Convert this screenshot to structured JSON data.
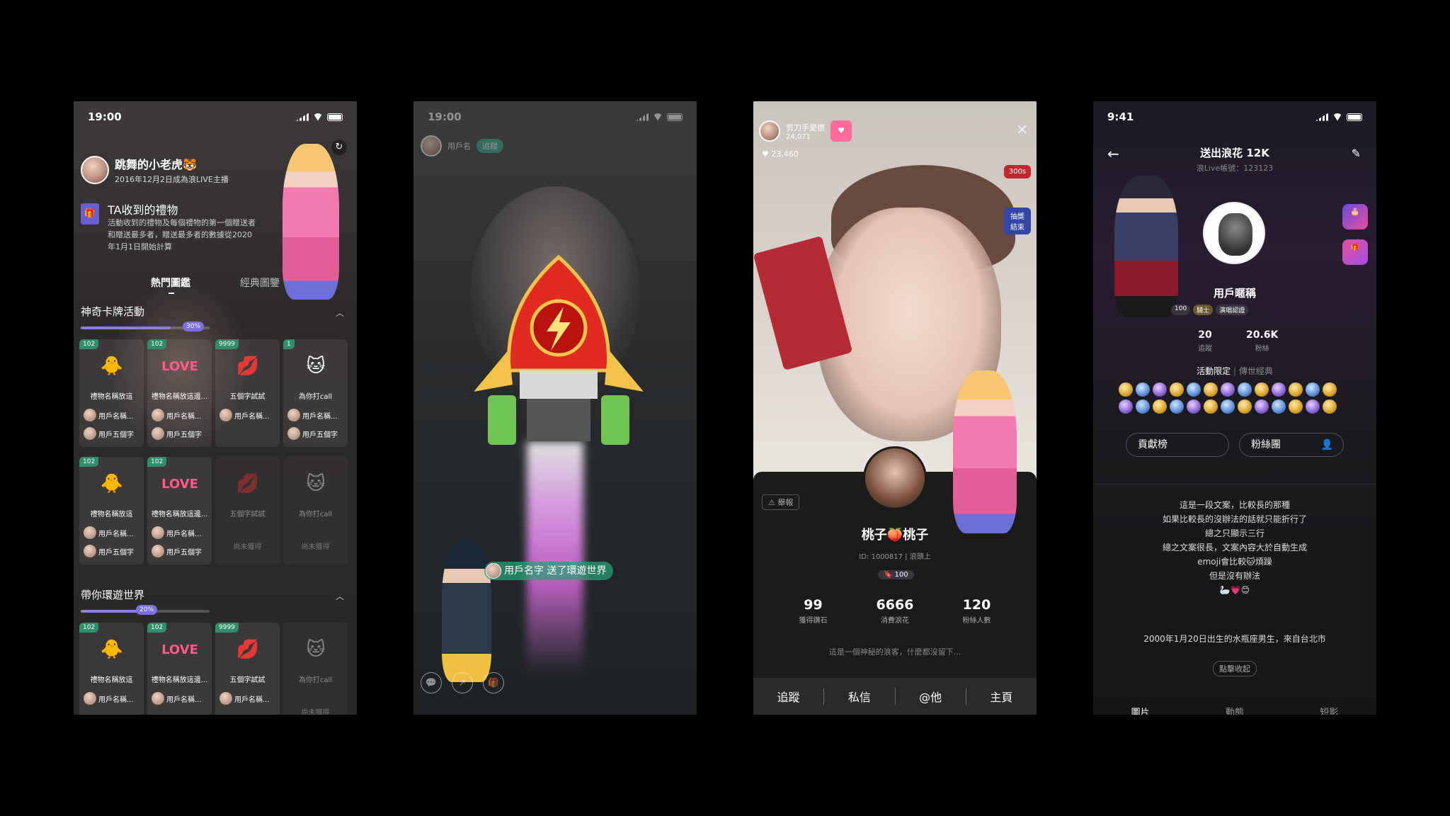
{
  "phone1": {
    "status_time": "19:00",
    "user_name": "跳舞的小老虎🐯",
    "user_sub": "2016年12月2日成為浪LIVE主播",
    "section_title": "TA收到的禮物",
    "section_desc": "活動收到的禮物及每個禮物的第一個贈送者和贈送最多者，贈送最多者的數據從2020年1月1日開始計算",
    "tab_hot": "熱門圖鑑",
    "tab_classic": "經典圖鑒",
    "group1_title": "神奇卡牌活動",
    "group1_progress": "30%",
    "group2_title": "帶你環遊世界",
    "group2_progress": "20%",
    "cards": [
      {
        "badge": "102",
        "name": "禮物名稱放這",
        "u1": "用戶名稱...",
        "u2": "用戶五個字",
        "icon": "🐥"
      },
      {
        "badge": "102",
        "name": "禮物名稱放這邊...",
        "u1": "用戶名稱...",
        "u2": "用戶五個字",
        "icon": "LOVE"
      },
      {
        "badge": "9999",
        "name": "五個字試試",
        "u1": "用戶名稱...",
        "u2": "",
        "icon": "💋"
      },
      {
        "badge": "1",
        "name": "為你打call",
        "u1": "用戶名稱...",
        "u2": "用戶五個字",
        "icon": "🐱"
      },
      {
        "badge": "102",
        "name": "禮物名稱放這",
        "u1": "用戶名稱...",
        "u2": "用戶五個字",
        "icon": "🐥"
      },
      {
        "badge": "102",
        "name": "禮物名稱放這邊...",
        "u1": "用戶名稱...",
        "u2": "用戶五個字",
        "icon": "LOVE"
      },
      {
        "badge": "",
        "name": "五個字試試",
        "u1": "",
        "u2": "",
        "icon": "💋",
        "locked": "尚未獲得"
      },
      {
        "badge": "",
        "name": "為你打call",
        "u1": "",
        "u2": "",
        "icon": "🐱",
        "locked": "尚未獲得"
      },
      {
        "badge": "102",
        "name": "禮物名稱放這",
        "u1": "用戶名稱...",
        "u2": "",
        "icon": "🐥"
      },
      {
        "badge": "102",
        "name": "禮物名稱放這邊...",
        "u1": "用戶名稱...",
        "u2": "",
        "icon": "LOVE"
      },
      {
        "badge": "9999",
        "name": "五個字試試",
        "u1": "用戶名稱...",
        "u2": "",
        "icon": "💋"
      },
      {
        "badge": "",
        "name": "為你打call",
        "u1": "",
        "u2": "",
        "icon": "🐱",
        "locked": "尚未獲得"
      }
    ]
  },
  "phone2": {
    "status_time": "19:00",
    "banner": "用戶名字 送了環遊世界",
    "top_name": "用戶名",
    "follow": "追蹤"
  },
  "phone3": {
    "top_name": "剪刀手愛德",
    "top_count": "24,071",
    "likes": "23,460",
    "side1": "300s",
    "side2_line1": "抽獎",
    "side2_line2": "結束",
    "report": "舉報",
    "name": "桃子🍑桃子",
    "id_line": "ID: 1000817 | 浪頭上",
    "level": "100",
    "stats": [
      {
        "v": "99",
        "l": "獲得鑽石"
      },
      {
        "v": "6666",
        "l": "消費浪花"
      },
      {
        "v": "120",
        "l": "粉絲人數"
      }
    ],
    "bio": "這是一個神秘的浪客，什麼都沒留下...",
    "actions": [
      "追蹤",
      "私信",
      "@他",
      "主頁"
    ]
  },
  "phone4": {
    "status_time": "9:41",
    "title": "送出浪花 12K",
    "account": "浪Live帳號：123123",
    "name": "用戶暱稱",
    "level": "100",
    "tag_knight": "騎士",
    "tag_verified": "演唱認證",
    "stats": [
      {
        "v": "20",
        "l": "追蹤"
      },
      {
        "v": "20.6K",
        "l": "粉絲"
      }
    ],
    "tab_active": "活動限定",
    "tab_other": "傳世經典",
    "contrib": "貢獻榜",
    "fans": "粉絲團",
    "bio_lines": [
      "這是一段文案，比較長的那種",
      "如果比較長的沒辦法的話就只能折行了",
      "總之只顯示三行",
      "總之文案很長，文案內容大於自動生成",
      "emoji會比較🐱煩躁",
      "但是沒有辦法",
      "🦢💗😊"
    ],
    "birth": "2000年1月20日出生的水瓶座男生，來自台北市",
    "collapse": "點擊收起",
    "bottom_tabs": [
      "圖片",
      "動態",
      "短影"
    ]
  }
}
